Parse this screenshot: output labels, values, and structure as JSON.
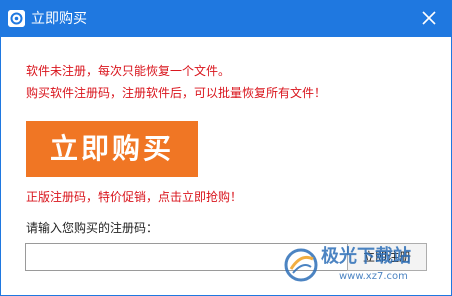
{
  "window": {
    "title": "立即购买",
    "icon": "app-logo-icon",
    "close_icon": "close-icon"
  },
  "notices": {
    "line1": "软件未注册，每次只能恢复一个文件。",
    "line2": "购买软件注册码，注册软件后，可以批量恢复所有文件！"
  },
  "buy_button": {
    "label": "立即购买"
  },
  "promo": "正版注册码，特价促销，点击立即抢购！",
  "registration": {
    "label": "请输入您购买的注册码：",
    "input_value": "",
    "button_label": "立即注册"
  },
  "watermark": {
    "name": "极光下载站",
    "url": "www.xz7.com"
  },
  "colors": {
    "titlebar": "#1f78e0",
    "buy_button": "#f07624",
    "notice_text": "#d9141c"
  }
}
